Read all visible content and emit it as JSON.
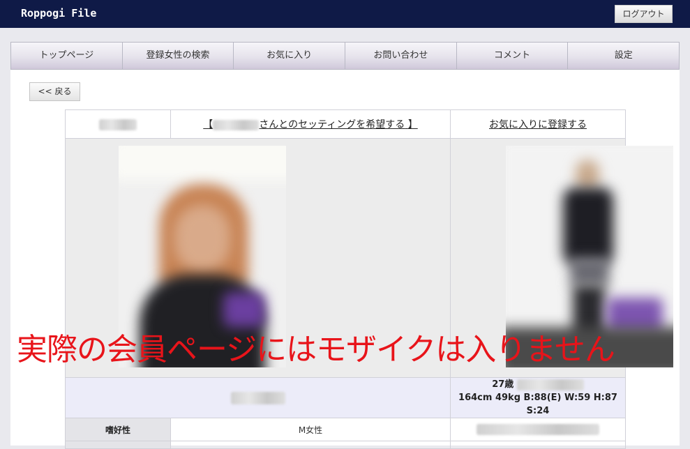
{
  "header": {
    "logo": "Roppogi File",
    "logout_label": "ログアウト",
    "bg_color": "#0f1a47"
  },
  "nav": {
    "items": [
      {
        "label": "トップページ"
      },
      {
        "label": "登録女性の検索"
      },
      {
        "label": "お気に入り"
      },
      {
        "label": "お問い合わせ"
      },
      {
        "label": "コメント"
      },
      {
        "label": "設定"
      }
    ]
  },
  "back_label": "<< 戻る",
  "profile": {
    "setting_link_prefix": "【",
    "setting_link_text": "さんとのセッティングを希望する",
    "setting_link_suffix": "】",
    "favorite_link": "お気に入りに登録する",
    "age": "27歳",
    "measurements": "164cm  49kg  B:88(E) W:59 H:87 S:24",
    "attributes": [
      {
        "label": "嗜好性",
        "value": "M女性"
      }
    ]
  },
  "overlay_text": "実際の会員ページにはモザイクは入りません",
  "colors": {
    "overlay": "#e8141a",
    "info_bg": "#ececf9"
  }
}
